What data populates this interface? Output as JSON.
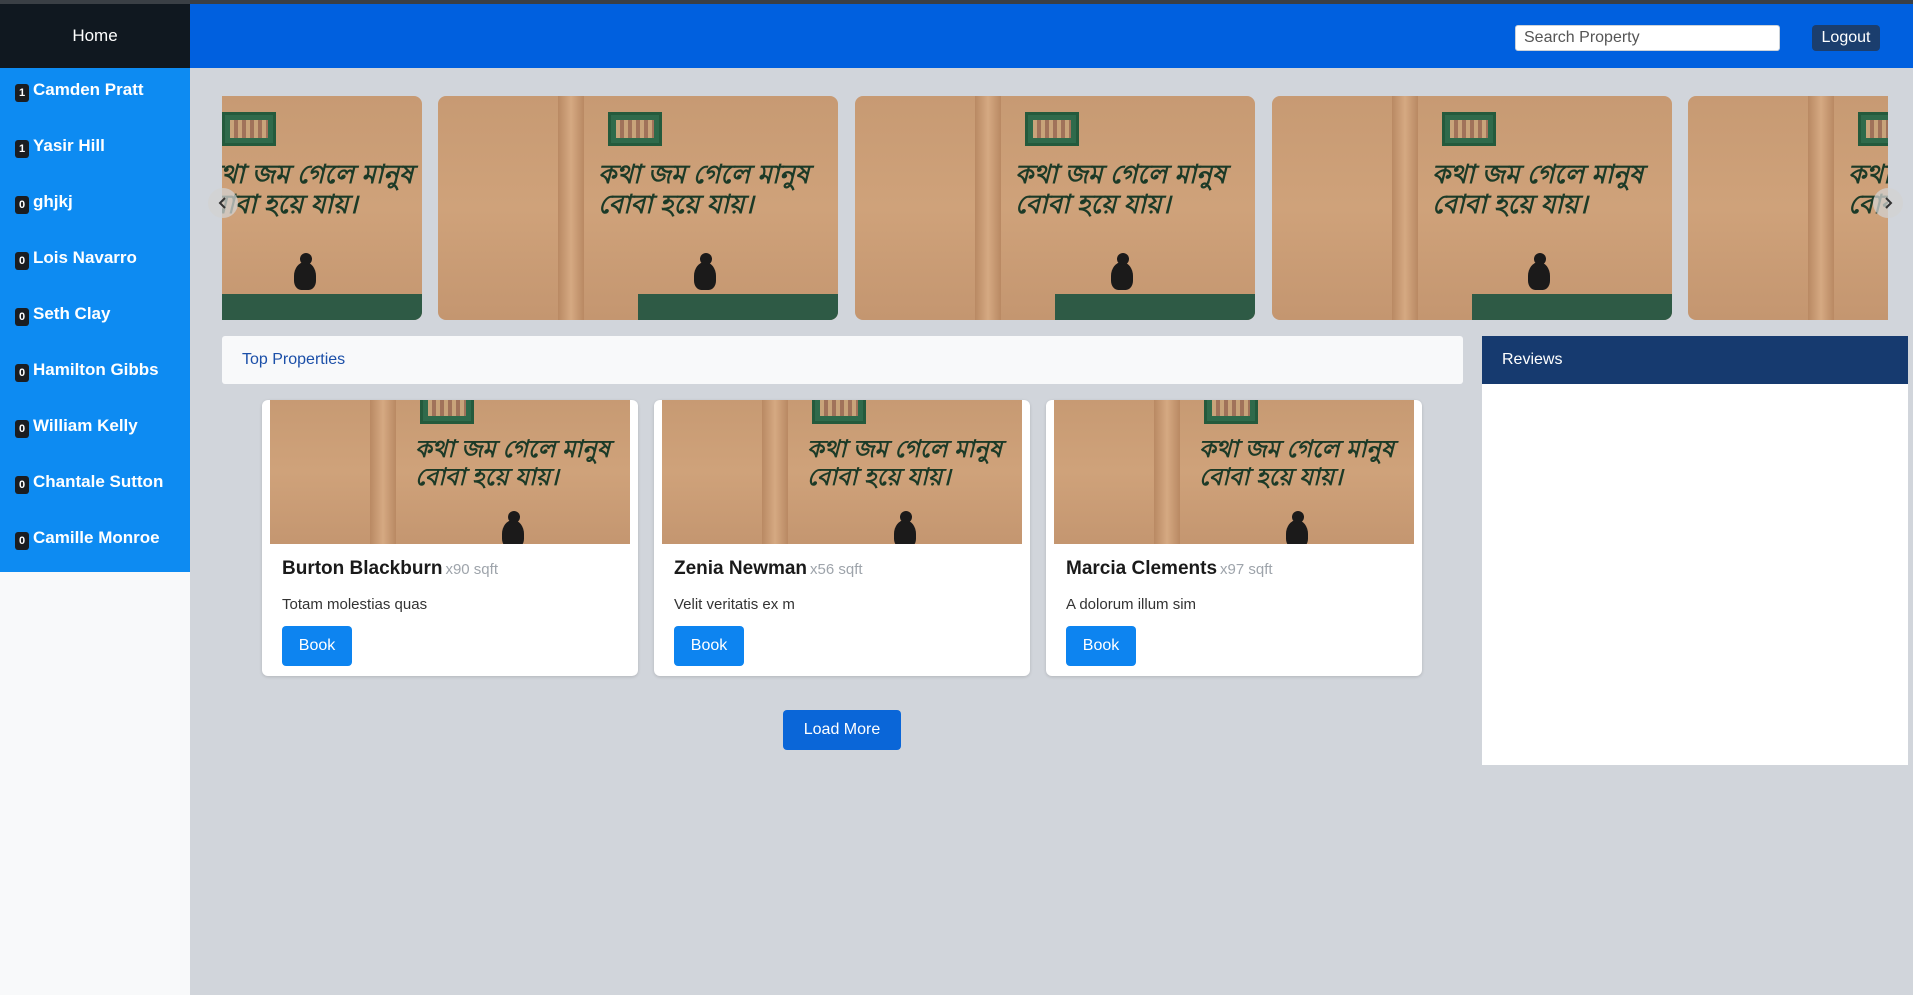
{
  "sidebar": {
    "home_label": "Home",
    "items": [
      {
        "badge": "1",
        "label": "Camden Pratt"
      },
      {
        "badge": "1",
        "label": "Yasir Hill"
      },
      {
        "badge": "0",
        "label": "ghjkj"
      },
      {
        "badge": "0",
        "label": "Lois Navarro"
      },
      {
        "badge": "0",
        "label": "Seth Clay"
      },
      {
        "badge": "0",
        "label": "Hamilton Gibbs"
      },
      {
        "badge": "0",
        "label": "William Kelly"
      },
      {
        "badge": "0",
        "label": "Chantale Sutton"
      },
      {
        "badge": "0",
        "label": "Camille Monroe"
      }
    ]
  },
  "header": {
    "search_placeholder": "Search Property",
    "logout_label": "Logout"
  },
  "carousel": {
    "prev_icon": "chevron-left-icon",
    "next_icon": "chevron-right-icon"
  },
  "top_properties": {
    "title": "Top Properties",
    "cards": [
      {
        "name": "Burton Blackburn",
        "area": "x90 sqft",
        "description": "Totam molestias quas",
        "button": "Book"
      },
      {
        "name": "Zenia Newman",
        "area": "x56 sqft",
        "description": "Velit veritatis ex m",
        "button": "Book"
      },
      {
        "name": "Marcia Clements",
        "area": "x97 sqft",
        "description": "A dolorum illum sim",
        "button": "Book"
      }
    ],
    "load_more_label": "Load More"
  },
  "reviews": {
    "title": "Reviews"
  },
  "colors": {
    "header_bg": "#0060df",
    "sidebar_bg": "#0d8bf2",
    "reviews_header_bg": "#163a6f",
    "button_bg": "#0d84f0"
  }
}
